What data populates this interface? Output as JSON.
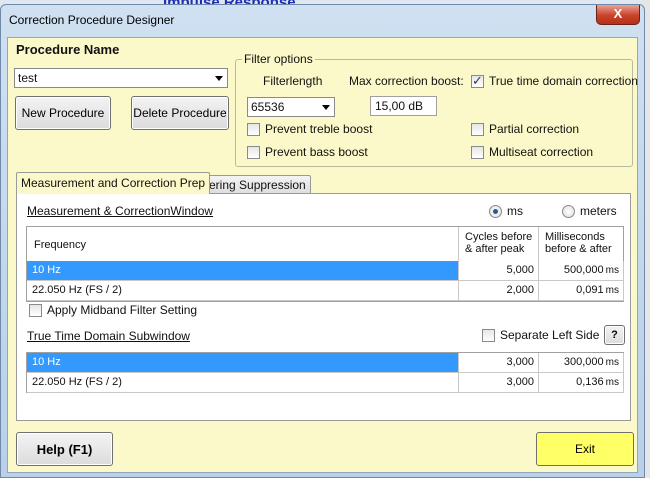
{
  "background": {
    "title": "Impulse Response"
  },
  "window": {
    "title": "Correction Procedure Designer",
    "close_label": "X"
  },
  "procedure": {
    "title": "Procedure Name",
    "value": "test",
    "new_button": "New Procedure",
    "delete_button": "Delete Procedure"
  },
  "filter_options": {
    "legend": "Filter options",
    "filterlength_label": "Filterlength",
    "filterlength_value": "65536",
    "max_boost_label": "Max correction boost:",
    "max_boost_value": "15,00 dB",
    "true_time_label": "True time domain correction",
    "true_time_checked": true,
    "prevent_treble_label": "Prevent treble boost",
    "prevent_bass_label": "Prevent bass boost",
    "partial_label": "Partial correction",
    "multiseat_label": "Multiseat correction"
  },
  "tabs": [
    {
      "label": "Measurement and Correction Prep",
      "active": true
    },
    {
      "label": "Prering Suppression",
      "active": false
    }
  ],
  "measurement": {
    "section_title": "Measurement & CorrectionWindow",
    "unit_ms": "ms",
    "unit_meters": "meters",
    "selected_unit": "ms",
    "headers": {
      "frequency": "Frequency",
      "cycles_1": "Cycles before",
      "cycles_2": "& after peak",
      "ms_1": "Milliseconds",
      "ms_2": "before & after"
    },
    "rows": [
      {
        "frequency": "10 Hz",
        "cycles": "5,000",
        "ms": "500,000",
        "unit": "ms"
      },
      {
        "frequency": "22.050 Hz (FS / 2)",
        "cycles": "2,000",
        "ms": "0,091",
        "unit": "ms"
      }
    ],
    "midband_label": "Apply Midband Filter Setting"
  },
  "subwindow": {
    "section_title": "True Time Domain Subwindow",
    "separate_label": "Separate Left Side",
    "help_glyph": "?",
    "rows": [
      {
        "frequency": "10 Hz",
        "cycles": "3,000",
        "ms": "300,000",
        "unit": "ms"
      },
      {
        "frequency": "22.050 Hz (FS / 2)",
        "cycles": "3,000",
        "ms": "0,136",
        "unit": "ms"
      }
    ]
  },
  "footer": {
    "help_button": "Help (F1)",
    "exit_button": "Exit"
  }
}
